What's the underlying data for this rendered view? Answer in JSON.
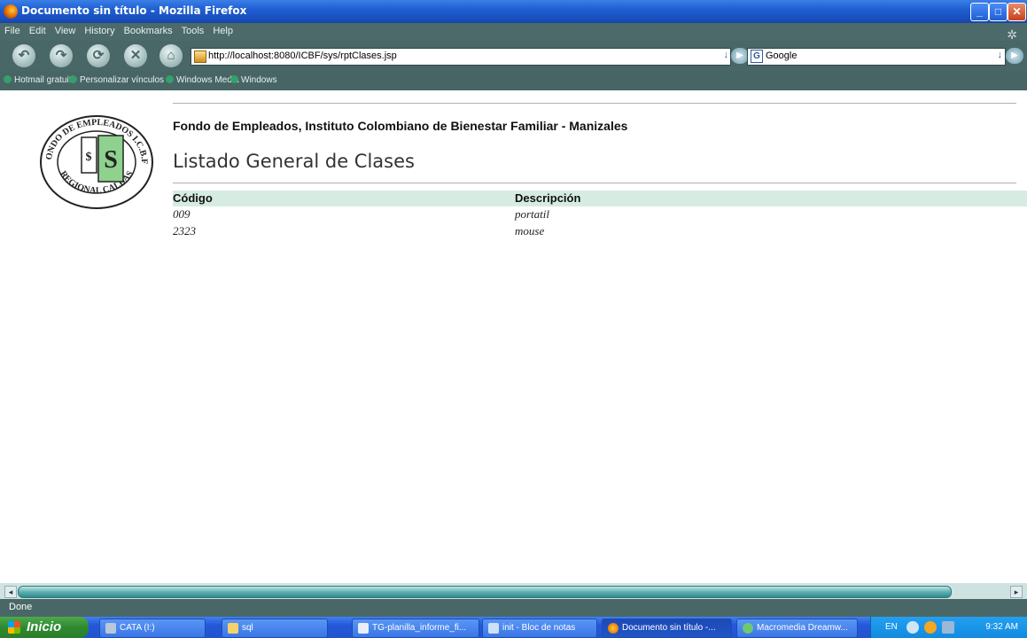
{
  "window": {
    "title": "Documento sin título - Mozilla Firefox"
  },
  "menu": [
    "File",
    "Edit",
    "View",
    "History",
    "Bookmarks",
    "Tools",
    "Help"
  ],
  "navbar": {
    "url": "http://localhost:8080/ICBF/sys/rptClases.jsp",
    "search_engine": "Google"
  },
  "bookmarks": [
    "Hotmail gratuito",
    "Personalizar vínculos",
    "Windows Media",
    "Windows"
  ],
  "page": {
    "organization": "Fondo de Empleados, Instituto Colombiano de Bienestar Familiar - Manizales",
    "heading": "Listado General de Clases",
    "table": {
      "columns": [
        "Código",
        "Descripción"
      ],
      "rows": [
        {
          "codigo": "009",
          "descripcion": "portatil"
        },
        {
          "codigo": "2323",
          "descripcion": "mouse"
        }
      ]
    },
    "logo_text": {
      "top": "FONDO DE EMPLEADOS I.C.B.F.",
      "bottom": "REGIONAL CALDAS",
      "monogram": "S$"
    }
  },
  "statusbar": {
    "status": "Done"
  },
  "taskbar": {
    "start_label": "Inicio",
    "tasks": [
      "CATA (I:)",
      "sql",
      "TG-planilla_informe_fi...",
      "init - Bloc de notas",
      "Documento sin título -...",
      "Macromedia Dreamw..."
    ],
    "language": "EN",
    "clock": "9:32 AM"
  },
  "colors": {
    "titlebar": "#1f5fd3",
    "chrome": "#4a6767",
    "table_header": "#d6ece2",
    "logo_green": "#8fd18f"
  }
}
